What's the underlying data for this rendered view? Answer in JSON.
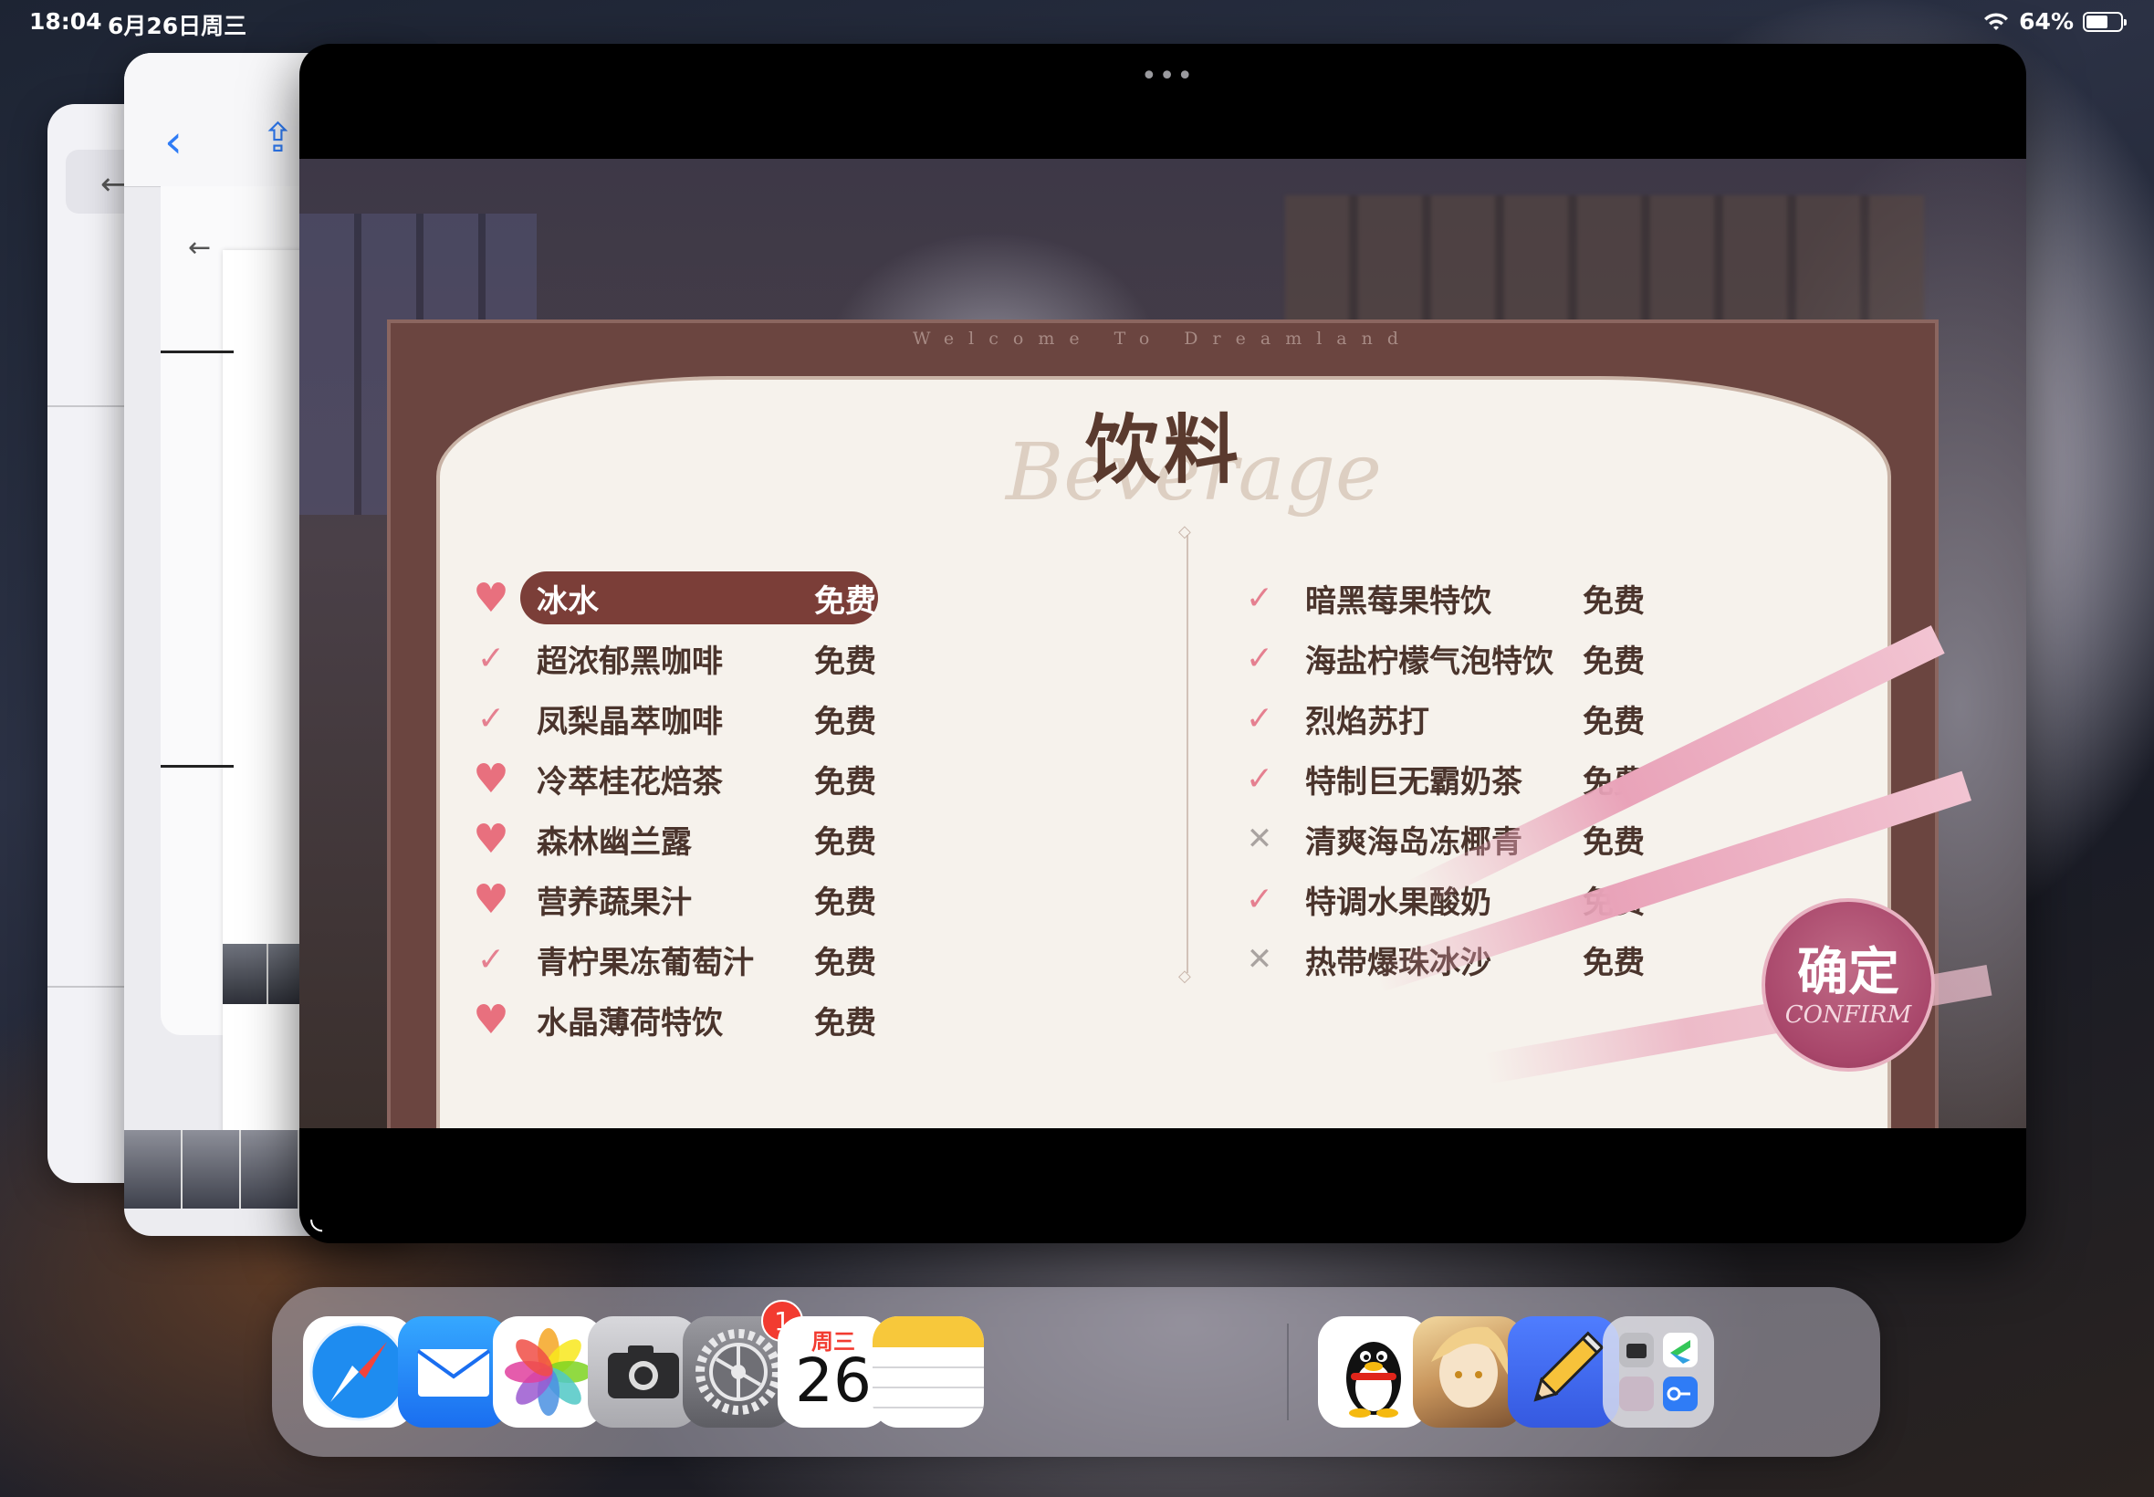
{
  "status_bar": {
    "time": "18:04",
    "date": "6月26日周三",
    "battery": "64%",
    "battery_level": 0.64
  },
  "window": {
    "more_dots": "•••"
  },
  "game_menu": {
    "welcome": "Welcome To Dreamland",
    "title": "饮料",
    "title_script": "Beverage",
    "left_items": [
      {
        "mark": "heart",
        "name": "冰水",
        "price": "免费",
        "selected": true
      },
      {
        "mark": "check",
        "name": "超浓郁黑咖啡",
        "price": "免费"
      },
      {
        "mark": "check",
        "name": "凤梨晶萃咖啡",
        "price": "免费"
      },
      {
        "mark": "heart",
        "name": "冷萃桂花焙茶",
        "price": "免费"
      },
      {
        "mark": "heart",
        "name": "森林幽兰露",
        "price": "免费"
      },
      {
        "mark": "heart",
        "name": "营养蔬果汁",
        "price": "免费"
      },
      {
        "mark": "check",
        "name": "青柠果冻葡萄汁",
        "price": "免费"
      },
      {
        "mark": "heart",
        "name": "水晶薄荷特饮",
        "price": "免费"
      }
    ],
    "right_items": [
      {
        "mark": "check",
        "name": "暗黑莓果特饮",
        "price": "免费"
      },
      {
        "mark": "check",
        "name": "海盐柠檬气泡特饮",
        "price": "免费"
      },
      {
        "mark": "check",
        "name": "烈焰苏打",
        "price": "免费"
      },
      {
        "mark": "check",
        "name": "特制巨无霸奶茶",
        "price": "免费"
      },
      {
        "mark": "cross",
        "name": "清爽海岛冻椰青",
        "price": "免费"
      },
      {
        "mark": "check",
        "name": "特调水果酸奶",
        "price": "免费"
      },
      {
        "mark": "cross",
        "name": "热带爆珠冰沙",
        "price": "免费"
      }
    ],
    "confirm_cn": "确定",
    "confirm_en": "CONFIRM"
  },
  "dock": {
    "apps": [
      {
        "name": "Safari",
        "icon": "compass-icon"
      },
      {
        "name": "Mail",
        "icon": "envelope-icon"
      },
      {
        "name": "Photos",
        "icon": "flower-icon"
      },
      {
        "name": "Camera",
        "icon": "camera-icon"
      },
      {
        "name": "Settings",
        "icon": "gear-icon",
        "badge": "1"
      },
      {
        "name": "Calendar",
        "icon": "calendar-icon",
        "weekday": "周三",
        "day": "26"
      },
      {
        "name": "Notes",
        "icon": "notes-icon"
      },
      {
        "name": "QQ",
        "icon": "penguin-icon"
      },
      {
        "name": "Game",
        "icon": "character-icon"
      },
      {
        "name": "Pencil App",
        "icon": "pencil-icon"
      },
      {
        "name": "App Library",
        "icon": "folder-icon"
      }
    ]
  },
  "colors": {
    "accent": "#7b3e38",
    "heart": "#e8707e",
    "dock_blue": "#2f7cf6"
  }
}
